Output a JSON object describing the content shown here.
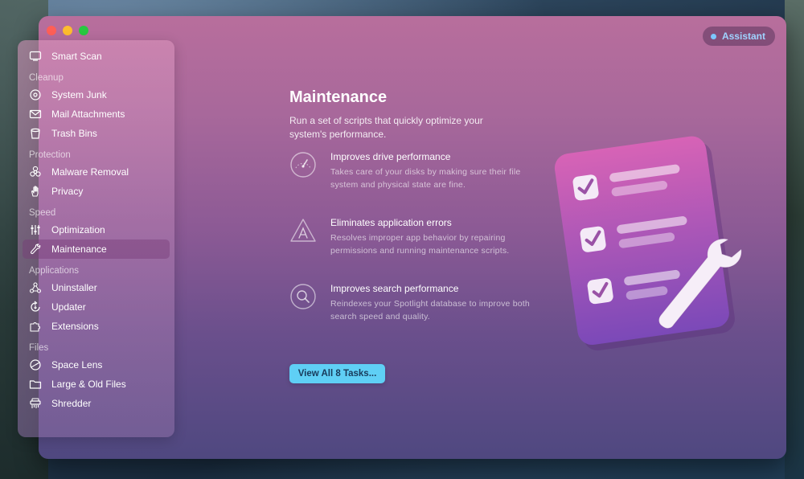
{
  "window": {
    "assistant_label": "Assistant"
  },
  "sidebar": {
    "top": {
      "label": "Smart Scan",
      "icon": "monitor-icon"
    },
    "sections": [
      {
        "title": "Cleanup",
        "items": [
          {
            "label": "System Junk",
            "icon": "disk-icon"
          },
          {
            "label": "Mail Attachments",
            "icon": "mail-icon"
          },
          {
            "label": "Trash Bins",
            "icon": "trash-icon"
          }
        ]
      },
      {
        "title": "Protection",
        "items": [
          {
            "label": "Malware Removal",
            "icon": "biohazard-icon"
          },
          {
            "label": "Privacy",
            "icon": "hand-icon"
          }
        ]
      },
      {
        "title": "Speed",
        "items": [
          {
            "label": "Optimization",
            "icon": "sliders-icon"
          },
          {
            "label": "Maintenance",
            "icon": "wrench-icon",
            "active": true
          }
        ]
      },
      {
        "title": "Applications",
        "items": [
          {
            "label": "Uninstaller",
            "icon": "uninstaller-icon"
          },
          {
            "label": "Updater",
            "icon": "updater-icon"
          },
          {
            "label": "Extensions",
            "icon": "extensions-icon"
          }
        ]
      },
      {
        "title": "Files",
        "items": [
          {
            "label": "Space Lens",
            "icon": "space-lens-icon"
          },
          {
            "label": "Large & Old Files",
            "icon": "folder-icon"
          },
          {
            "label": "Shredder",
            "icon": "shredder-icon"
          }
        ]
      }
    ]
  },
  "main": {
    "title": "Maintenance",
    "description": "Run a set of scripts that quickly optimize your system's performance.",
    "features": [
      {
        "title": "Improves drive performance",
        "text": "Takes care of your disks by making sure their file system and physical state are fine.",
        "icon": "gauge-icon"
      },
      {
        "title": "Eliminates application errors",
        "text": "Resolves improper app behavior by repairing permissions and running maintenance scripts.",
        "icon": "app-warning-icon"
      },
      {
        "title": "Improves search performance",
        "text": "Reindexes your Spotlight database to improve both search speed and quality.",
        "icon": "search-icon"
      }
    ],
    "cta_label": "View All 8 Tasks..."
  },
  "colors": {
    "accent_button": "#5fcff5",
    "assistant_text": "#9fd3ff"
  }
}
